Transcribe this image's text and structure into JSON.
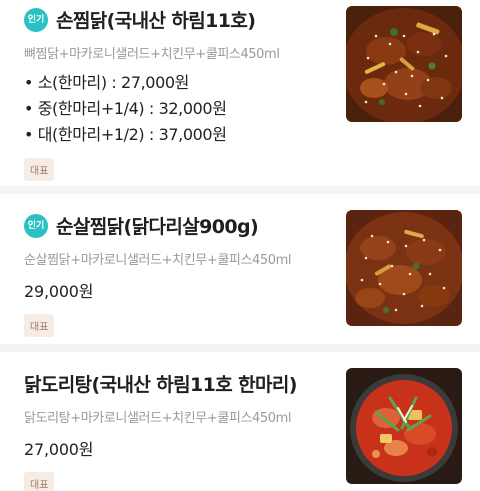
{
  "menu": {
    "items": [
      {
        "badge": "인기",
        "name": "손찜닭(국내산 하림11호)",
        "description": "뼈찜닭+마카로니샐러드+치킨무+쿨피스450ml",
        "options": [
          "• 소(한마리) : 27,000원",
          "• 중(한마리+1/4) : 32,000원",
          "• 대(한마리+1/2) : 37,000원"
        ],
        "tag": "대표",
        "image": "braised-chicken-photo"
      },
      {
        "badge": "인기",
        "name": "순살찜닭(닭다리살900g)",
        "description": "순살찜닭+마카로니샐러드+치킨무+쿨피스450ml",
        "price": "29,000원",
        "tag": "대표",
        "image": "boneless-braised-chicken-photo"
      },
      {
        "name": "닭도리탕(국내산 하림11호 한마리)",
        "description": "닭도리탕+마카로니샐러드+치킨무+쿨피스450ml",
        "price": "27,000원",
        "tag": "대표",
        "image": "spicy-chicken-stew-photo"
      }
    ]
  },
  "colors": {
    "badge": "#2bc1c4",
    "tag_bg": "#f6ece4",
    "tag_text": "#9c7c66",
    "separator": "#f3f3f3"
  }
}
